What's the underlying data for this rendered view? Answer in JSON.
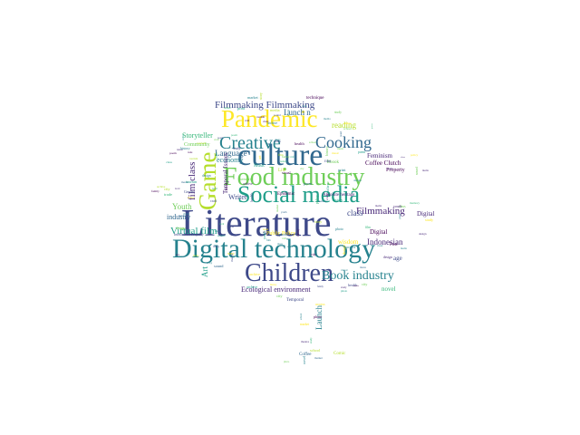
{
  "palette": [
    "#440154",
    "#482878",
    "#3e4989",
    "#31688e",
    "#26828e",
    "#1f9e89",
    "#35b779",
    "#6ece58",
    "#b5de2b",
    "#fde725"
  ],
  "words": [
    {
      "text": "Literature",
      "color": "#3e4989"
    },
    {
      "text": "Digital technology",
      "color": "#26828e"
    },
    {
      "text": "Food industry",
      "color": "#6ece58"
    },
    {
      "text": "culture",
      "color": "#31688e"
    },
    {
      "text": "Pandemic",
      "color": "#fde725"
    },
    {
      "text": "Social media",
      "color": "#1f9e89"
    },
    {
      "text": "Children",
      "color": "#3e4989"
    },
    {
      "text": "Creative",
      "color": "#26828e"
    },
    {
      "text": "Cooking",
      "color": "#31688e"
    },
    {
      "text": "Game",
      "color": "#b5de2b"
    },
    {
      "text": "Book industry",
      "color": "#26828e"
    },
    {
      "text": "Virtual film",
      "color": "#1f9e89"
    },
    {
      "text": "Filmmaking",
      "color": "#482878"
    },
    {
      "text": "Filmmaking Filmmaking",
      "color": "#3e4989"
    },
    {
      "text": "film class",
      "color": "#482878"
    },
    {
      "text": "Lunch n",
      "color": "#31688e"
    },
    {
      "text": "Storyteller",
      "color": "#35b779"
    },
    {
      "text": "Coffee Clutch",
      "color": "#440154"
    },
    {
      "text": "Feminism",
      "color": "#482878"
    },
    {
      "text": "Language",
      "color": "#31688e"
    },
    {
      "text": "economy",
      "color": "#26828e"
    },
    {
      "text": "Youth",
      "color": "#6ece58"
    },
    {
      "text": "Writer",
      "color": "#3e4989"
    },
    {
      "text": "industry",
      "color": "#31688e"
    },
    {
      "text": "Ecological environment",
      "color": "#482878"
    },
    {
      "text": "Indonesian",
      "color": "#482878"
    },
    {
      "text": "class",
      "color": "#3e4989"
    },
    {
      "text": "Launch",
      "color": "#26828e"
    },
    {
      "text": "wisdom",
      "color": "#fde725"
    },
    {
      "text": "reading",
      "color": "#b5de2b"
    },
    {
      "text": "novel",
      "color": "#35b779"
    },
    {
      "text": "Digital",
      "color": "#440154"
    },
    {
      "text": "Public Policy",
      "color": "#fde725"
    },
    {
      "text": "Temporal Issues",
      "color": "#482878"
    },
    {
      "text": "Community",
      "color": "#6ece58"
    },
    {
      "text": "age",
      "color": "#3e4989"
    },
    {
      "text": "Property",
      "color": "#440154"
    },
    {
      "text": "Music",
      "color": "#1f9e89"
    },
    {
      "text": "Intellectual Property",
      "color": "#3e4989"
    },
    {
      "text": "Absolute heritage",
      "color": "#482878"
    },
    {
      "text": "Epidemic",
      "color": "#440154"
    },
    {
      "text": "technique",
      "color": "#440154"
    },
    {
      "text": "Gender",
      "color": "#3e4989"
    },
    {
      "text": "Post",
      "color": "#440154"
    },
    {
      "text": "Art",
      "color": "#1f9e89"
    },
    {
      "text": "Life",
      "color": "#b5de2b"
    },
    {
      "text": "Coffee",
      "color": "#31688e"
    },
    {
      "text": "Comic",
      "color": "#b5de2b"
    },
    {
      "text": "Digital",
      "color": "#482878"
    },
    {
      "text": "Temporal",
      "color": "#3e4989"
    },
    {
      "text": "Ebook",
      "color": "#6ece58"
    }
  ],
  "filler": [
    "study",
    "design",
    "local",
    "media",
    "story",
    "poem",
    "print",
    "read",
    "film",
    "market",
    "policy",
    "art",
    "city",
    "youth",
    "voice",
    "brand",
    "trade",
    "class",
    "tourism",
    "theatre",
    "archive",
    "family",
    "novel",
    "health",
    "craft",
    "access",
    "online",
    "history",
    "nature",
    "memory",
    "school",
    "sound",
    "photo",
    "label",
    "visual",
    "music"
  ]
}
